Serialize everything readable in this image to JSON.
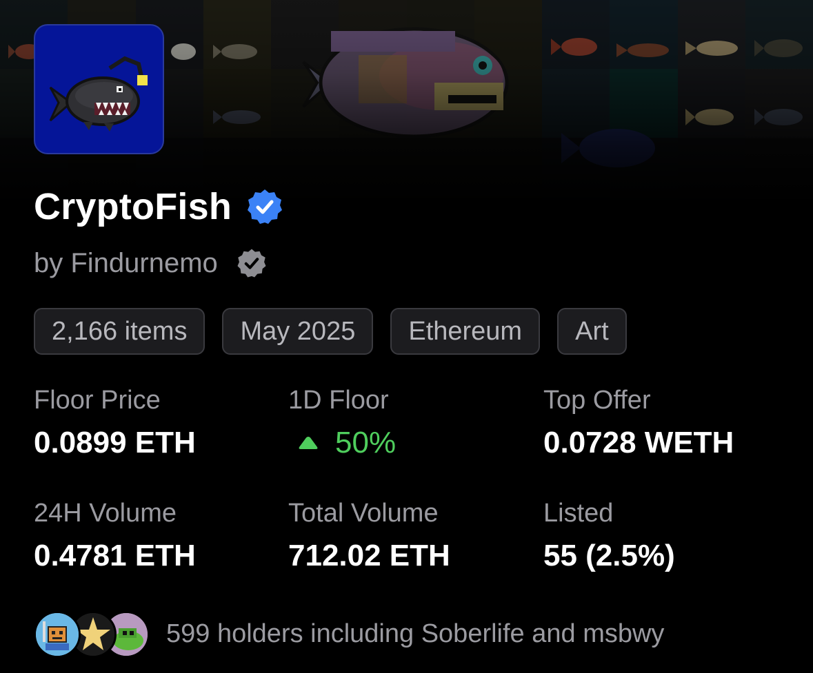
{
  "collection": {
    "name": "CryptoFish",
    "creator": "by Findurnemo",
    "verified": true
  },
  "tags": [
    {
      "label": "2,166 items"
    },
    {
      "label": "May 2025"
    },
    {
      "label": "Ethereum"
    },
    {
      "label": "Art"
    }
  ],
  "stats": {
    "floor_price": {
      "label": "Floor Price",
      "value": "0.0899 ETH"
    },
    "one_day_floor": {
      "label": "1D Floor",
      "value": "50%",
      "trend": "up"
    },
    "top_offer": {
      "label": "Top Offer",
      "value": "0.0728 WETH"
    },
    "volume_24h": {
      "label": "24H Volume",
      "value": "0.4781 ETH"
    },
    "total_volume": {
      "label": "Total Volume",
      "value": "712.02 ETH"
    },
    "listed": {
      "label": "Listed",
      "value": "55 (2.5%)"
    }
  },
  "holders": {
    "text": "599 holders including Soberlife and msbwy"
  },
  "colors": {
    "background": "#000000",
    "avatar_bg": "#051598",
    "verified_blue": "#3b82f6",
    "verified_gray": "#8e8e93",
    "trend_green": "#4fce5d",
    "label_gray": "#9b9ba1",
    "tag_border": "#3a3a3f"
  },
  "icons": {
    "verified": "verified-badge-icon",
    "creator_verified": "creator-verified-badge-icon",
    "trend": "up-arrow-icon"
  }
}
